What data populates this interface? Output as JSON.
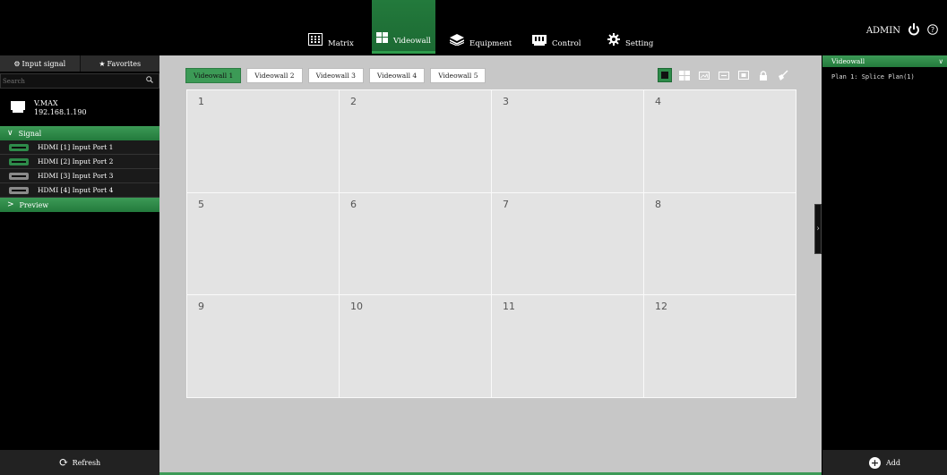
{
  "topbar": {
    "nav": [
      {
        "label": "Matrix",
        "icon": "grid-icon"
      },
      {
        "label": "Videowall",
        "icon": "tiles-icon",
        "active": true
      },
      {
        "label": "Equipment",
        "icon": "layers-icon"
      },
      {
        "label": "Control",
        "icon": "control-icon"
      },
      {
        "label": "Setting",
        "icon": "gear-icon"
      }
    ],
    "user": "ADMIN"
  },
  "left": {
    "tabs": [
      "Input signal",
      "Favorites"
    ],
    "search_placeholder": "Search",
    "device": {
      "name": "V.MAX",
      "ip": "192.168.1.190"
    },
    "signal_header": "Signal",
    "signals": [
      "HDMI [1] Input Port 1",
      "HDMI [2] Input Port 2",
      "HDMI [3] Input Port 3",
      "HDMI [4] Input Port 4"
    ],
    "preview_header": "Preview",
    "refresh_label": "Refresh"
  },
  "center": {
    "tabs": [
      "Videowall 1",
      "Videowall 2",
      "Videowall 3",
      "Videowall 4",
      "Videowall 5"
    ],
    "selected_tab": "Videowall 1",
    "cells": [
      "1",
      "2",
      "3",
      "4",
      "5",
      "6",
      "7",
      "8",
      "9",
      "10",
      "11",
      "12"
    ]
  },
  "right": {
    "header": "Videowall",
    "plan": "Plan 1: Splice Plan(1)",
    "add_label": "Add"
  },
  "colors": {
    "accent": "#2e8b4a",
    "canvas": "#c7c7c7",
    "cell": "#e3e3e3"
  }
}
